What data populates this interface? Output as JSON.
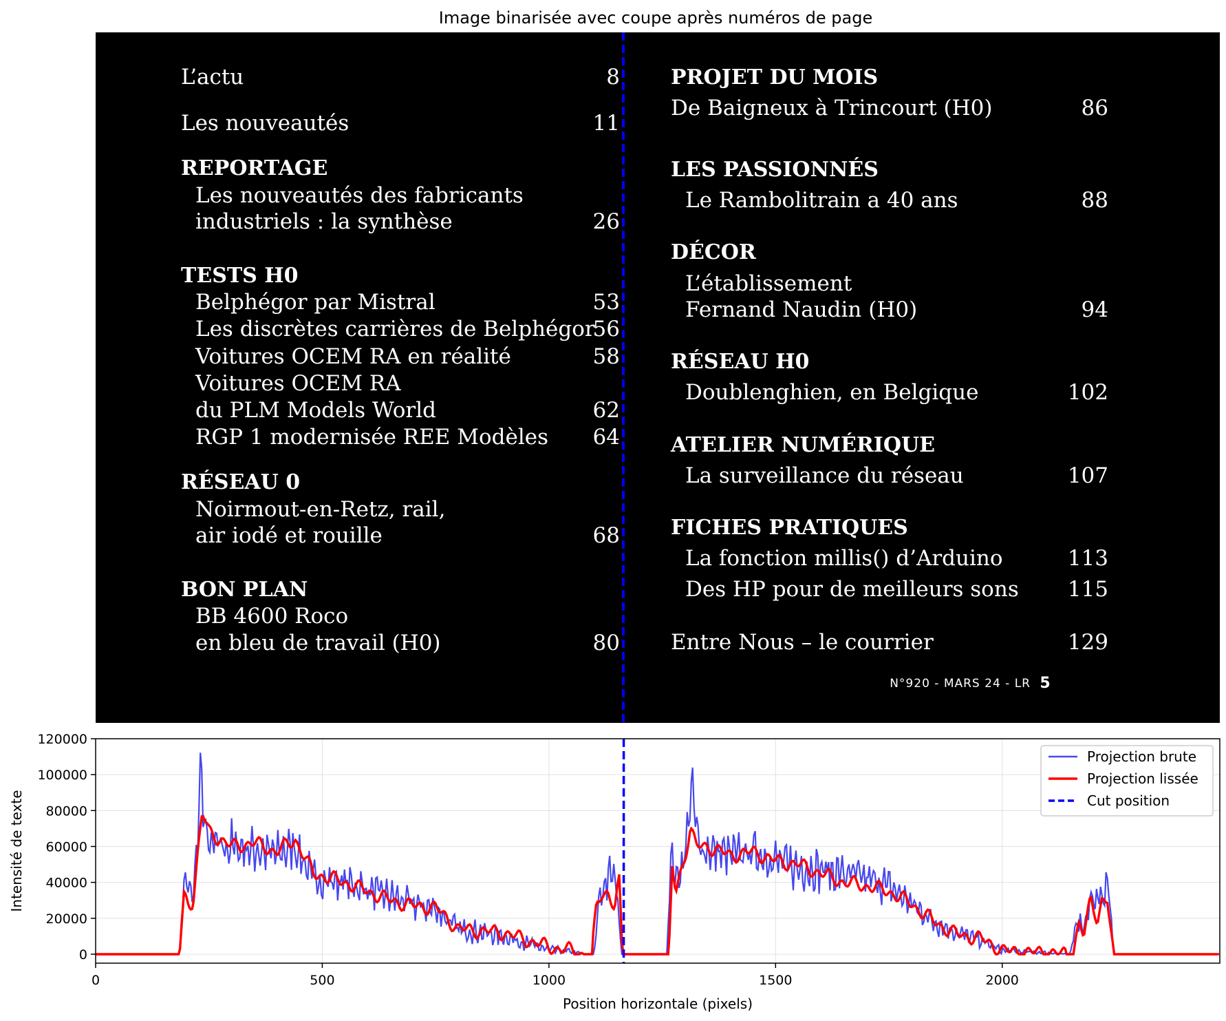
{
  "image_panel": {
    "title": "Image binarisée avec coupe après numéros de page",
    "left_column": [
      {
        "text": "L’actu",
        "page": "8",
        "heading": false
      },
      {
        "text": "Les nouveautés",
        "page": "11",
        "heading": false
      },
      {
        "text": "REPORTAGE",
        "page": "",
        "heading": true
      },
      {
        "text": "Les nouveautés des fabricants",
        "page": "",
        "heading": false
      },
      {
        "text": "industriels : la synthèse",
        "page": "26",
        "heading": false
      },
      {
        "text": "TESTS H0",
        "page": "",
        "heading": true
      },
      {
        "text": "Belphégor par Mistral",
        "page": "53",
        "heading": false
      },
      {
        "text": "Les discrètes carrières de Belphégor",
        "page": "56",
        "heading": false
      },
      {
        "text": "Voitures OCEM RA en réalité",
        "page": "58",
        "heading": false
      },
      {
        "text": "Voitures OCEM RA",
        "page": "",
        "heading": false
      },
      {
        "text": "du PLM Models World",
        "page": "62",
        "heading": false
      },
      {
        "text": "RGP 1 modernisée REE Modèles",
        "page": "64",
        "heading": false
      },
      {
        "text": "RÉSEAU 0",
        "page": "",
        "heading": true
      },
      {
        "text": "Noirmout-en-Retz, rail,",
        "page": "",
        "heading": false
      },
      {
        "text": "air iodé et rouille",
        "page": "68",
        "heading": false
      },
      {
        "text": "BON PLAN",
        "page": "",
        "heading": true
      },
      {
        "text": "BB 4600 Roco",
        "page": "",
        "heading": false
      },
      {
        "text": "en bleu de travail (H0)",
        "page": "80",
        "heading": false
      }
    ],
    "right_column": [
      {
        "text": "PROJET DU MOIS",
        "page": "",
        "heading": true
      },
      {
        "text": "De Baigneux à Trincourt (H0)",
        "page": "86",
        "heading": false
      },
      {
        "text": "LES PASSIONNÉS",
        "page": "",
        "heading": true
      },
      {
        "text": "Le Rambolitrain a 40 ans",
        "page": "88",
        "heading": false
      },
      {
        "text": "DÉCOR",
        "page": "",
        "heading": true
      },
      {
        "text": "L’établissement",
        "page": "",
        "heading": false
      },
      {
        "text": "Fernand Naudin (H0)",
        "page": "94",
        "heading": false
      },
      {
        "text": "RÉSEAU H0",
        "page": "",
        "heading": true
      },
      {
        "text": "Doublenghien, en Belgique",
        "page": "102",
        "heading": false
      },
      {
        "text": "ATELIER NUMÉRIQUE",
        "page": "",
        "heading": true
      },
      {
        "text": "La surveillance du réseau",
        "page": "107",
        "heading": false
      },
      {
        "text": "FICHES PRATIQUES",
        "page": "",
        "heading": true
      },
      {
        "text": "La fonction millis() d’Arduino",
        "page": "113",
        "heading": false
      },
      {
        "text": "Des HP pour de meilleurs sons",
        "page": "115",
        "heading": false
      },
      {
        "text": "Entre Nous – le courrier",
        "page": "129",
        "heading": false
      }
    ],
    "folio": "N°920 - MARS 24 - LR",
    "folio_number": "5"
  },
  "chart_data": {
    "type": "line",
    "title": "",
    "xlabel": "Position horizontale (pixels)",
    "ylabel": "Intensité de texte",
    "xlim": [
      0,
      2480
    ],
    "ylim": [
      -5000,
      120000
    ],
    "xticks": [
      0,
      500,
      1000,
      1500,
      2000
    ],
    "yticks": [
      0,
      20000,
      40000,
      60000,
      80000,
      100000,
      120000
    ],
    "grid": true,
    "legend_position": "top-right",
    "cut_position": 1165,
    "series": [
      {
        "name": "Projection brute",
        "color": "#4747ee",
        "style": "oscillating",
        "x": [
          0,
          185,
          195,
          205,
          215,
          225,
          232,
          240,
          250,
          300,
          350,
          400,
          440,
          480,
          550,
          600,
          650,
          700,
          750,
          800,
          850,
          900,
          950,
          1000,
          1050,
          1080,
          1100,
          1110,
          1125,
          1140,
          1150,
          1160,
          1165,
          1170,
          1260,
          1270,
          1280,
          1300,
          1315,
          1330,
          1350,
          1400,
          1450,
          1500,
          1550,
          1600,
          1650,
          1700,
          1750,
          1800,
          1850,
          1900,
          1950,
          2000,
          2050,
          2100,
          2150,
          2165,
          2180,
          2195,
          2210,
          2225,
          2235,
          2245,
          2480
        ],
        "y": [
          0,
          0,
          42000,
          38000,
          30000,
          65000,
          110000,
          70000,
          60000,
          60000,
          58000,
          56000,
          60000,
          42000,
          40000,
          36000,
          32000,
          28000,
          25000,
          14000,
          12000,
          10000,
          6000,
          2500,
          1500,
          0,
          0,
          30000,
          40000,
          45000,
          38000,
          0,
          0,
          0,
          0,
          58000,
          40000,
          55000,
          95000,
          60000,
          58000,
          55000,
          57000,
          52000,
          48000,
          47000,
          45000,
          42000,
          38000,
          28000,
          18000,
          12000,
          8000,
          2000,
          1200,
          800,
          0,
          20000,
          15000,
          32000,
          28000,
          35000,
          40000,
          0,
          0
        ],
        "amplitude": [
          0,
          0,
          6000,
          6000,
          6000,
          12000,
          10000,
          14000,
          14000,
          14000,
          12000,
          12000,
          12000,
          10000,
          10000,
          10000,
          9000,
          9000,
          8000,
          6000,
          6000,
          5000,
          4000,
          2500,
          1500,
          0,
          0,
          10000,
          12000,
          12000,
          10000,
          0,
          0,
          0,
          0,
          8000,
          8000,
          12000,
          12000,
          12000,
          12000,
          12000,
          12000,
          12000,
          12000,
          12000,
          11000,
          11000,
          10000,
          8000,
          7000,
          5000,
          4000,
          2000,
          1200,
          800,
          0,
          6000,
          6000,
          8000,
          8000,
          8000,
          10000,
          0,
          0
        ]
      },
      {
        "name": "Projection lissée",
        "color": "#ff0000",
        "x": [
          0,
          185,
          195,
          205,
          215,
          225,
          235,
          250,
          300,
          350,
          400,
          440,
          480,
          550,
          600,
          650,
          700,
          750,
          800,
          850,
          900,
          950,
          1000,
          1050,
          1075,
          1095,
          1105,
          1115,
          1130,
          1145,
          1155,
          1162,
          1168,
          1265,
          1272,
          1280,
          1300,
          1312,
          1325,
          1350,
          1400,
          1450,
          1500,
          1550,
          1600,
          1650,
          1700,
          1750,
          1800,
          1850,
          1900,
          1950,
          2000,
          2050,
          2100,
          2140,
          2155,
          2170,
          2180,
          2195,
          2210,
          2220,
          2232,
          2245,
          2480
        ],
        "y": [
          0,
          0,
          32000,
          28000,
          30000,
          55000,
          79000,
          68000,
          60000,
          62000,
          57000,
          64000,
          45000,
          40000,
          35000,
          30000,
          27000,
          26000,
          14000,
          13000,
          12000,
          8000,
          4000,
          2000,
          0,
          0,
          27000,
          33000,
          35000,
          26000,
          40000,
          0,
          0,
          0,
          48000,
          35000,
          55000,
          70000,
          60000,
          60000,
          55000,
          57000,
          52000,
          50000,
          45000,
          40000,
          38000,
          35000,
          28000,
          18000,
          11000,
          9000,
          2000,
          1000,
          1000,
          0,
          0,
          18000,
          10000,
          30000,
          20000,
          30000,
          30000,
          0,
          0
        ]
      }
    ]
  },
  "legend": {
    "raw": "Projection brute",
    "smooth": "Projection lissée",
    "cut": "Cut position"
  }
}
